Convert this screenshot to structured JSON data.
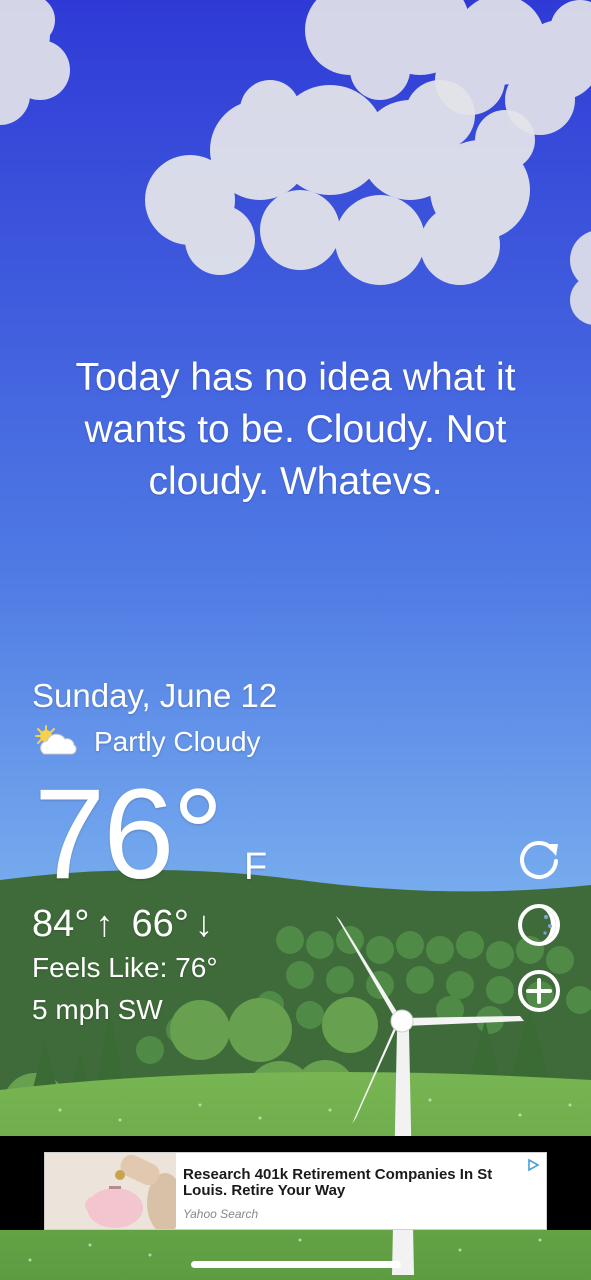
{
  "message": "Today has no idea what it wants to be. Cloudy. Not cloudy. Whatevs.",
  "weather": {
    "date": "Sunday, June 12",
    "condition": "Partly Cloudy",
    "condition_icon": "partly-cloudy-icon",
    "temperature": "76°",
    "unit": "F",
    "high": "84°",
    "low": "66°",
    "feels_like": "Feels Like: 76°",
    "wind": "5 mph SW"
  },
  "actions": [
    {
      "name": "refresh",
      "icon": "refresh-icon"
    },
    {
      "name": "theme",
      "icon": "moon-icon"
    },
    {
      "name": "add",
      "icon": "plus-circle-icon"
    }
  ],
  "ad": {
    "title": "Research 401k Retirement Companies In St Louis. Retire Your Way",
    "source": "Yahoo Search",
    "choice_icon": "adchoices-icon"
  },
  "colors": {
    "sky_top": "#2f3fd9",
    "sky_bottom": "#7fb6f0",
    "hill_dark": "#3f6b3a",
    "grass": "#6aa84f",
    "text": "#ffffff"
  }
}
